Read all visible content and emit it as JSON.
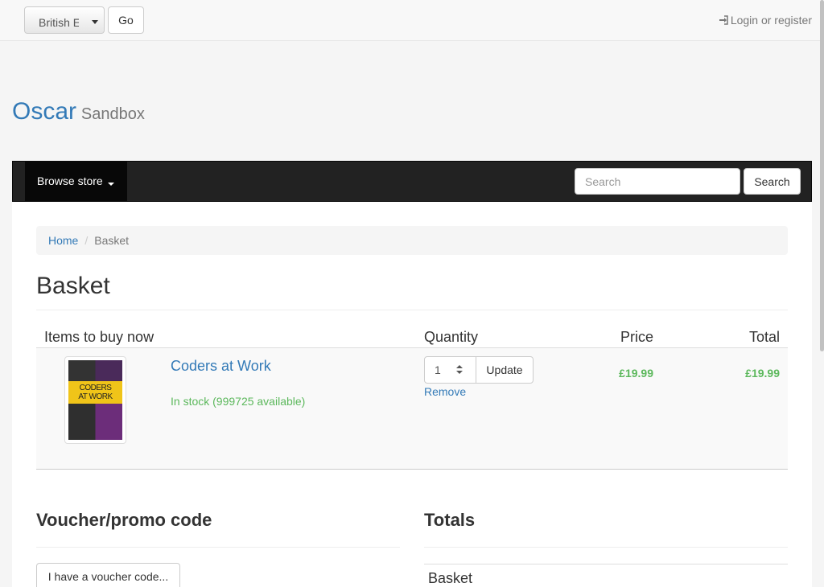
{
  "topbar": {
    "language_value": "British English",
    "go_label": "Go",
    "login_label": "Login or register"
  },
  "brand": {
    "name": "Oscar",
    "subtitle": "Sandbox"
  },
  "navbar": {
    "browse_label": "Browse store",
    "search_placeholder": "Search",
    "search_button": "Search"
  },
  "breadcrumb": {
    "home": "Home",
    "current": "Basket"
  },
  "page": {
    "title": "Basket"
  },
  "basket": {
    "headers": {
      "items": "Items to buy now",
      "quantity": "Quantity",
      "price": "Price",
      "total": "Total"
    },
    "lines": [
      {
        "title": "Coders at Work",
        "availability": "In stock (999725 available)",
        "quantity": "1",
        "update_label": "Update",
        "remove_label": "Remove",
        "price": "£19.99",
        "total": "£19.99",
        "cover_text": "CODERS AT WORK"
      }
    ]
  },
  "voucher": {
    "title": "Voucher/promo code",
    "button_label": "I have a voucher code..."
  },
  "totals": {
    "title": "Totals",
    "basket_label": "Basket"
  },
  "colors": {
    "link": "#337ab7",
    "success": "#5cb85c",
    "navbar": "#222222"
  }
}
